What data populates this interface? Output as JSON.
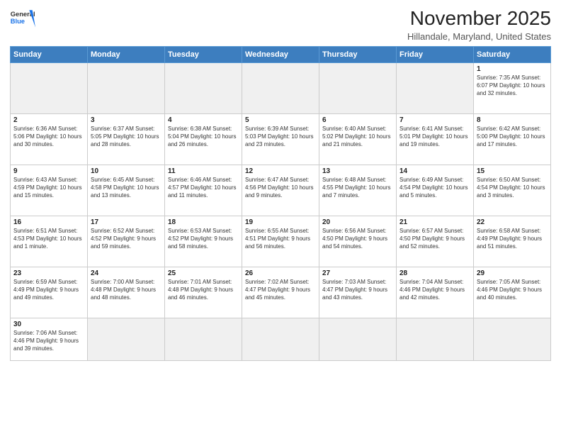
{
  "header": {
    "logo_general": "General",
    "logo_blue": "Blue",
    "month_title": "November 2025",
    "location": "Hillandale, Maryland, United States"
  },
  "days_of_week": [
    "Sunday",
    "Monday",
    "Tuesday",
    "Wednesday",
    "Thursday",
    "Friday",
    "Saturday"
  ],
  "weeks": [
    [
      {
        "day": "",
        "info": ""
      },
      {
        "day": "",
        "info": ""
      },
      {
        "day": "",
        "info": ""
      },
      {
        "day": "",
        "info": ""
      },
      {
        "day": "",
        "info": ""
      },
      {
        "day": "",
        "info": ""
      },
      {
        "day": "1",
        "info": "Sunrise: 7:35 AM\nSunset: 6:07 PM\nDaylight: 10 hours and 32 minutes."
      }
    ],
    [
      {
        "day": "2",
        "info": "Sunrise: 6:36 AM\nSunset: 5:06 PM\nDaylight: 10 hours and 30 minutes."
      },
      {
        "day": "3",
        "info": "Sunrise: 6:37 AM\nSunset: 5:05 PM\nDaylight: 10 hours and 28 minutes."
      },
      {
        "day": "4",
        "info": "Sunrise: 6:38 AM\nSunset: 5:04 PM\nDaylight: 10 hours and 26 minutes."
      },
      {
        "day": "5",
        "info": "Sunrise: 6:39 AM\nSunset: 5:03 PM\nDaylight: 10 hours and 23 minutes."
      },
      {
        "day": "6",
        "info": "Sunrise: 6:40 AM\nSunset: 5:02 PM\nDaylight: 10 hours and 21 minutes."
      },
      {
        "day": "7",
        "info": "Sunrise: 6:41 AM\nSunset: 5:01 PM\nDaylight: 10 hours and 19 minutes."
      },
      {
        "day": "8",
        "info": "Sunrise: 6:42 AM\nSunset: 5:00 PM\nDaylight: 10 hours and 17 minutes."
      }
    ],
    [
      {
        "day": "9",
        "info": "Sunrise: 6:43 AM\nSunset: 4:59 PM\nDaylight: 10 hours and 15 minutes."
      },
      {
        "day": "10",
        "info": "Sunrise: 6:45 AM\nSunset: 4:58 PM\nDaylight: 10 hours and 13 minutes."
      },
      {
        "day": "11",
        "info": "Sunrise: 6:46 AM\nSunset: 4:57 PM\nDaylight: 10 hours and 11 minutes."
      },
      {
        "day": "12",
        "info": "Sunrise: 6:47 AM\nSunset: 4:56 PM\nDaylight: 10 hours and 9 minutes."
      },
      {
        "day": "13",
        "info": "Sunrise: 6:48 AM\nSunset: 4:55 PM\nDaylight: 10 hours and 7 minutes."
      },
      {
        "day": "14",
        "info": "Sunrise: 6:49 AM\nSunset: 4:54 PM\nDaylight: 10 hours and 5 minutes."
      },
      {
        "day": "15",
        "info": "Sunrise: 6:50 AM\nSunset: 4:54 PM\nDaylight: 10 hours and 3 minutes."
      }
    ],
    [
      {
        "day": "16",
        "info": "Sunrise: 6:51 AM\nSunset: 4:53 PM\nDaylight: 10 hours and 1 minute."
      },
      {
        "day": "17",
        "info": "Sunrise: 6:52 AM\nSunset: 4:52 PM\nDaylight: 9 hours and 59 minutes."
      },
      {
        "day": "18",
        "info": "Sunrise: 6:53 AM\nSunset: 4:52 PM\nDaylight: 9 hours and 58 minutes."
      },
      {
        "day": "19",
        "info": "Sunrise: 6:55 AM\nSunset: 4:51 PM\nDaylight: 9 hours and 56 minutes."
      },
      {
        "day": "20",
        "info": "Sunrise: 6:56 AM\nSunset: 4:50 PM\nDaylight: 9 hours and 54 minutes."
      },
      {
        "day": "21",
        "info": "Sunrise: 6:57 AM\nSunset: 4:50 PM\nDaylight: 9 hours and 52 minutes."
      },
      {
        "day": "22",
        "info": "Sunrise: 6:58 AM\nSunset: 4:49 PM\nDaylight: 9 hours and 51 minutes."
      }
    ],
    [
      {
        "day": "23",
        "info": "Sunrise: 6:59 AM\nSunset: 4:49 PM\nDaylight: 9 hours and 49 minutes."
      },
      {
        "day": "24",
        "info": "Sunrise: 7:00 AM\nSunset: 4:48 PM\nDaylight: 9 hours and 48 minutes."
      },
      {
        "day": "25",
        "info": "Sunrise: 7:01 AM\nSunset: 4:48 PM\nDaylight: 9 hours and 46 minutes."
      },
      {
        "day": "26",
        "info": "Sunrise: 7:02 AM\nSunset: 4:47 PM\nDaylight: 9 hours and 45 minutes."
      },
      {
        "day": "27",
        "info": "Sunrise: 7:03 AM\nSunset: 4:47 PM\nDaylight: 9 hours and 43 minutes."
      },
      {
        "day": "28",
        "info": "Sunrise: 7:04 AM\nSunset: 4:46 PM\nDaylight: 9 hours and 42 minutes."
      },
      {
        "day": "29",
        "info": "Sunrise: 7:05 AM\nSunset: 4:46 PM\nDaylight: 9 hours and 40 minutes."
      }
    ],
    [
      {
        "day": "30",
        "info": "Sunrise: 7:06 AM\nSunset: 4:46 PM\nDaylight: 9 hours and 39 minutes."
      },
      {
        "day": "",
        "info": ""
      },
      {
        "day": "",
        "info": ""
      },
      {
        "day": "",
        "info": ""
      },
      {
        "day": "",
        "info": ""
      },
      {
        "day": "",
        "info": ""
      },
      {
        "day": "",
        "info": ""
      }
    ]
  ]
}
